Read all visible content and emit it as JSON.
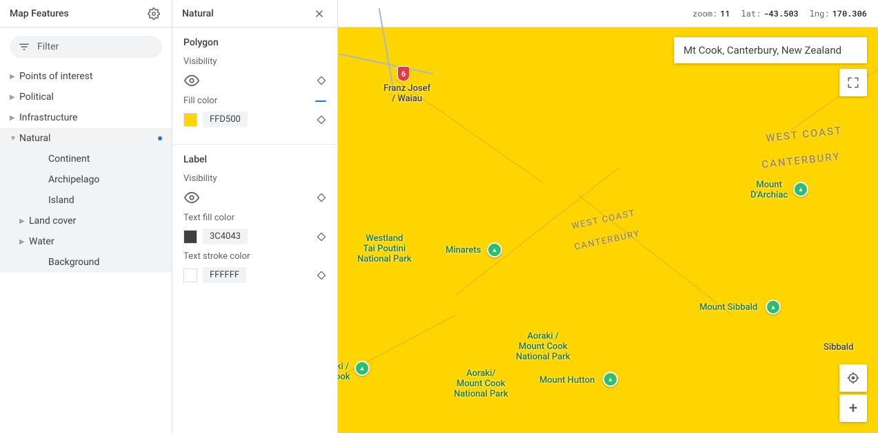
{
  "features_panel": {
    "title": "Map Features",
    "filter_placeholder": "Filter",
    "items": [
      {
        "label": "Points of interest",
        "expanded": false
      },
      {
        "label": "Political",
        "expanded": false
      },
      {
        "label": "Infrastructure",
        "expanded": false
      },
      {
        "label": "Natural",
        "expanded": true,
        "selected": true,
        "modified": true,
        "children": [
          {
            "label": "Continent"
          },
          {
            "label": "Archipelago"
          },
          {
            "label": "Island"
          },
          {
            "label": "Land cover",
            "has_children": true
          },
          {
            "label": "Water",
            "has_children": true
          },
          {
            "label": "Background"
          }
        ]
      }
    ]
  },
  "detail_panel": {
    "title": "Natural",
    "polygon": {
      "heading": "Polygon",
      "visibility_label": "Visibility",
      "fill_color_label": "Fill color",
      "fill_color": "FFD500",
      "fill_color_swatch": "#FFD500"
    },
    "label": {
      "heading": "Label",
      "visibility_label": "Visibility",
      "text_fill_label": "Text fill color",
      "text_fill": "3C4043",
      "text_fill_swatch": "#3C4043",
      "text_stroke_label": "Text stroke color",
      "text_stroke": "FFFFFF",
      "text_stroke_swatch": "#FFFFFF"
    }
  },
  "status": {
    "zoom_label": "zoom:",
    "zoom": "11",
    "lat_label": "lat:",
    "lat": "-43.503",
    "lng_label": "lng:",
    "lng": "170.306"
  },
  "search": {
    "value": "Mt Cook, Canterbury, New Zealand"
  },
  "map": {
    "fill_color": "#FFD500",
    "route_badge": "6",
    "places": {
      "franz_josef": "Franz Josef\n/ Waiau",
      "westland": "Westland\nTai Poutini\nNational Park",
      "minarets": "Minarets",
      "darchiac": "Mount\nD'Archiac",
      "sibbald_mt": "Mount Sibbald",
      "sibbald": "Sibbald",
      "aoraki_np1": "Aoraki /\nMount Cook\nNational Park",
      "aoraki_np2": "Aoraki/\nMount Cook\nNational Park",
      "hutton": "Mount Hutton",
      "ki_ook": "ki /\nook"
    },
    "regions": {
      "west_coast": "WEST COAST",
      "canterbury": "CANTERBURY"
    }
  }
}
